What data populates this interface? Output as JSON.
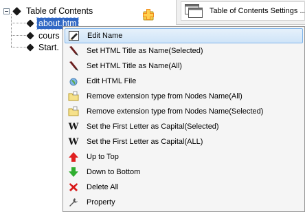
{
  "tree": {
    "root_label": "Table of Contents",
    "nodes": [
      {
        "label": "about.htm",
        "selected": true
      },
      {
        "label": "cours"
      },
      {
        "label": "Start."
      }
    ]
  },
  "panel": {
    "title": "Table of Contents Settings ..."
  },
  "context_menu": {
    "items": [
      {
        "label": "Edit Name",
        "icon": "edit-name-icon",
        "active": true
      },
      {
        "label": "Set HTML Title as Name(Selected)",
        "icon": "brush-icon"
      },
      {
        "label": "Set HTML Title as Name(All)",
        "icon": "brush-icon"
      },
      {
        "label": "Edit HTML File",
        "icon": "globe-icon"
      },
      {
        "label": "Remove extension type from Nodes Name(All)",
        "icon": "folder-icon"
      },
      {
        "label": "Remove extension type from Nodes Name(Selected)",
        "icon": "folder-icon"
      },
      {
        "label": "Set the First Letter as Capital(Selected)",
        "icon": "w-letter-icon"
      },
      {
        "label": "Set the First Letter as Capital(ALL)",
        "icon": "w-letter-icon"
      },
      {
        "label": "Up to Top",
        "icon": "up-arrow-icon"
      },
      {
        "label": "Down to Bottom",
        "icon": "down-arrow-icon"
      },
      {
        "label": "Delete All",
        "icon": "red-x-icon"
      },
      {
        "label": "Property",
        "icon": "wrench-icon"
      }
    ]
  },
  "colors": {
    "selection": "#3168c4",
    "menu_bg": "#f5f5f5",
    "menu_hover": "#cfe4f8",
    "up_arrow": "#e02020",
    "down_arrow": "#2fae2f",
    "delete_x": "#d81818"
  },
  "w_glyph": "W"
}
